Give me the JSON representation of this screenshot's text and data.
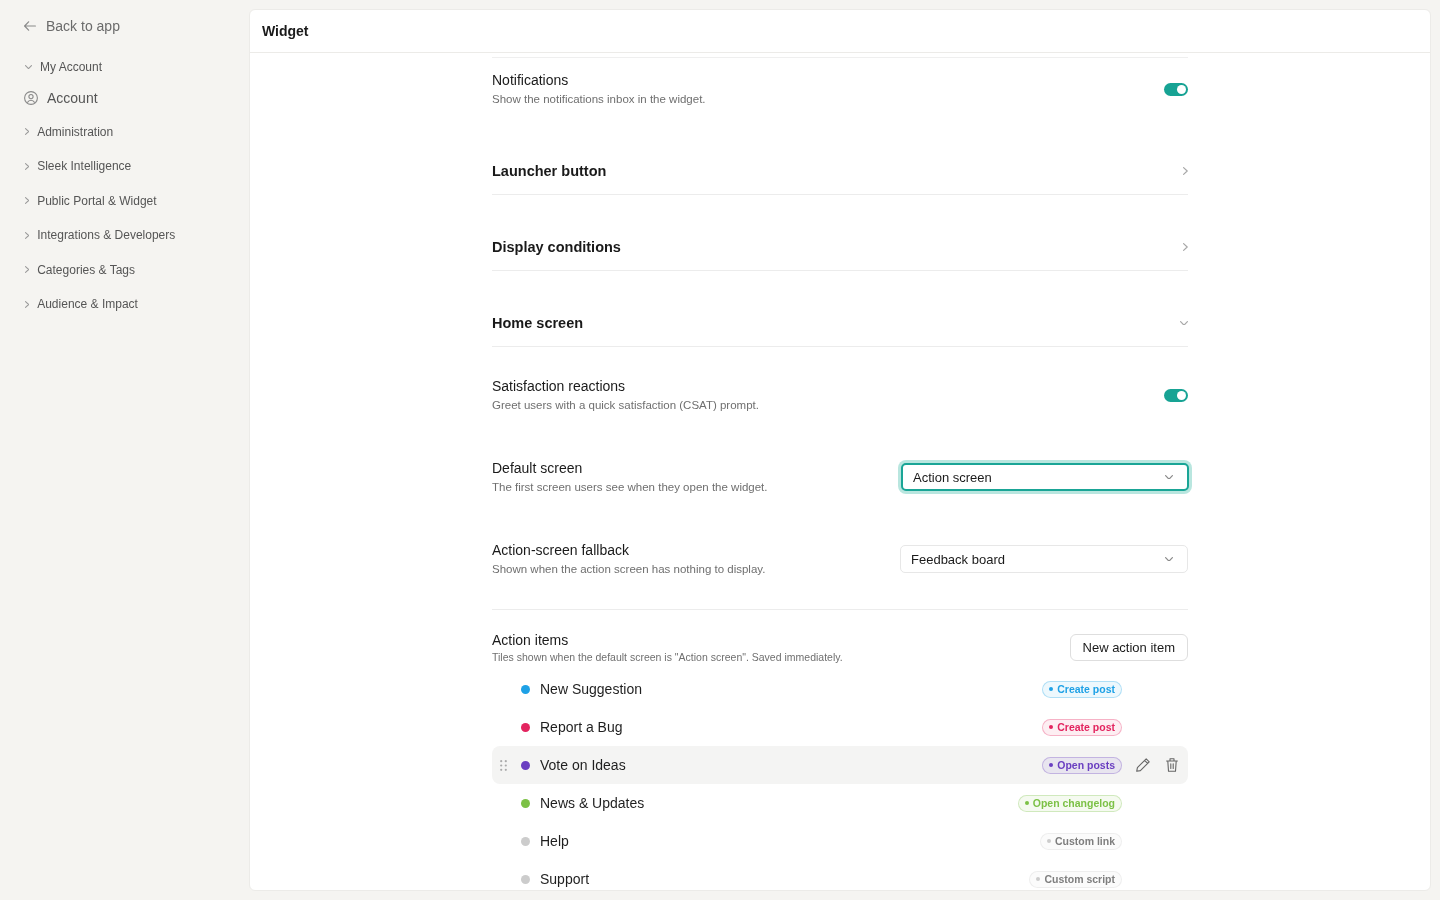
{
  "sidebar": {
    "back_link": "Back to app",
    "groups": [
      {
        "label": "My Account",
        "expanded": true,
        "children": [
          {
            "label": "Account"
          }
        ]
      },
      {
        "label": "Administration",
        "expanded": false
      },
      {
        "label": "Sleek Intelligence",
        "expanded": false
      },
      {
        "label": "Public Portal & Widget",
        "expanded": false
      },
      {
        "label": "Integrations & Developers",
        "expanded": false
      },
      {
        "label": "Categories & Tags",
        "expanded": false
      },
      {
        "label": "Audience & Impact",
        "expanded": false
      }
    ]
  },
  "panel": {
    "title": "Widget"
  },
  "settings": [
    {
      "kind": "toggle",
      "title": "Notifications",
      "description": "Show the notifications inbox in the widget.",
      "on": true
    },
    {
      "kind": "section",
      "title": "Launcher button",
      "expanded": false
    },
    {
      "kind": "section",
      "title": "Display conditions",
      "expanded": false
    },
    {
      "kind": "section",
      "title": "Home screen",
      "expanded": true
    },
    {
      "kind": "toggle",
      "title": "Satisfaction reactions",
      "description": "Greet users with a quick satisfaction (CSAT) prompt.",
      "on": true
    },
    {
      "kind": "select",
      "title": "Default screen",
      "description": "The first screen users see when they open the widget.",
      "value": "Action screen",
      "focused": true
    },
    {
      "kind": "select",
      "title": "Action-screen fallback",
      "description": "Shown when the action screen has nothing to display.",
      "value": "Feedback board",
      "focused": false
    }
  ],
  "action_items": {
    "title": "Action items",
    "description": "Tiles shown when the default screen is \"Action screen\". Saved immediately.",
    "button": "New action item",
    "items": [
      {
        "label": "New Suggestion",
        "color": "#1ea1e6",
        "action": "Create post",
        "hovered": false
      },
      {
        "label": "Report a Bug",
        "color": "#e3245f",
        "action": "Create post",
        "hovered": false
      },
      {
        "label": "Vote on Ideas",
        "color": "#6a3fc1",
        "action": "Open posts",
        "hovered": true
      },
      {
        "label": "News & Updates",
        "color": "#7cc146",
        "action": "Open changelog",
        "hovered": false
      },
      {
        "label": "Help",
        "color": "#cccccc",
        "action": "Custom link",
        "hovered": false
      },
      {
        "label": "Support",
        "color": "#cccccc",
        "action": "Custom script",
        "hovered": false
      }
    ]
  }
}
